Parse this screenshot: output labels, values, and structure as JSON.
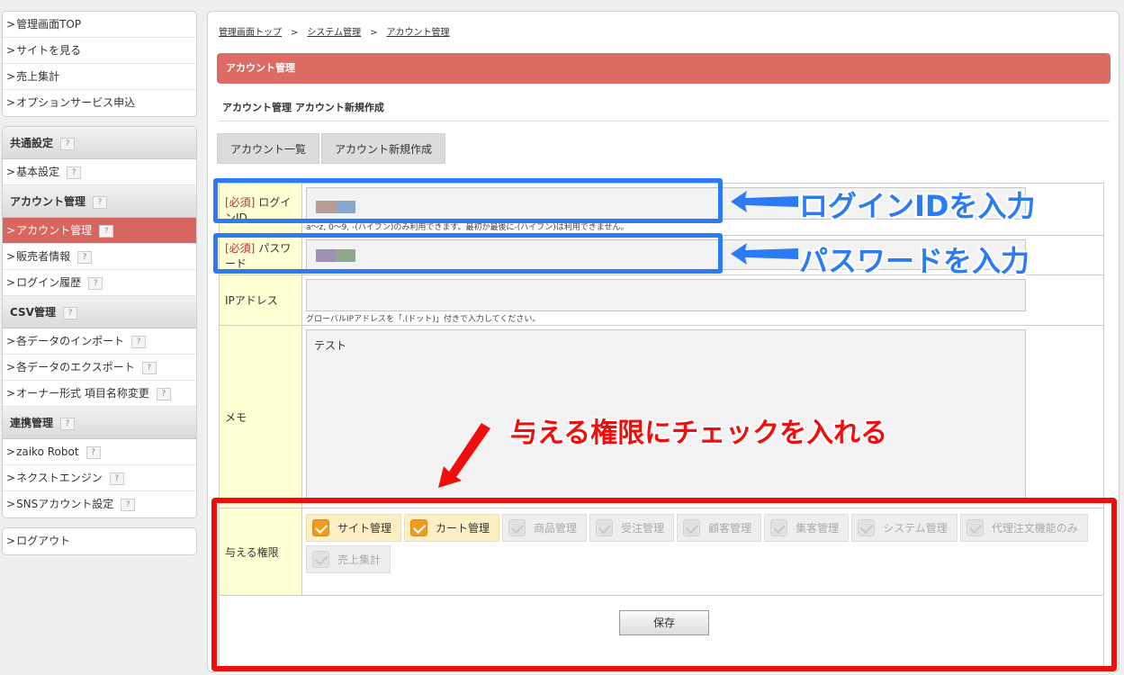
{
  "sidebar": {
    "top_items": [
      "管理画面TOP",
      "サイトを見る",
      "売上集計",
      "オプションサービス申込"
    ],
    "sections": [
      {
        "title": "共通設定",
        "items": [
          "基本設定"
        ]
      },
      {
        "title": "アカウント管理",
        "items": [
          "アカウント管理",
          "販売者情報",
          "ログイン履歴"
        ]
      },
      {
        "title": "CSV管理",
        "items": [
          "各データのインポート",
          "各データのエクスポート",
          "オーナー形式 項目名称変更"
        ]
      },
      {
        "title": "連携管理",
        "items": [
          "zaiko Robot",
          "ネクストエンジン",
          "SNSアカウント設定"
        ]
      }
    ],
    "logout": "ログアウト",
    "arrow": ">",
    "help": "?"
  },
  "breadcrumb": [
    "管理画面トップ",
    "システム管理",
    "アカウント管理"
  ],
  "breadcrumb_sep": ">",
  "page_title": "アカウント管理",
  "subtitle": "アカウント管理 アカウント新規作成",
  "tabs": [
    "アカウント一覧",
    "アカウント新規作成"
  ],
  "form": {
    "required_mark": "[必須]",
    "login_label": "ログインID",
    "login_hint": "a～z, 0～9, -(ハイフン)のみ利用できます。最初か最後に-(ハイフン)は利用できません。",
    "password_label": "パスワード",
    "ip_label": "IPアドレス",
    "ip_hint": "グローバルIPアドレスを「.(ドット)」付きで入力してください。",
    "memo_label": "メモ",
    "memo_value": "テスト",
    "perm_label": "与える権限",
    "permissions": [
      {
        "label": "サイト管理",
        "checked": true
      },
      {
        "label": "カート管理",
        "checked": true
      },
      {
        "label": "商品管理",
        "checked": false
      },
      {
        "label": "受注管理",
        "checked": false
      },
      {
        "label": "顧客管理",
        "checked": false
      },
      {
        "label": "集客管理",
        "checked": false
      },
      {
        "label": "システム管理",
        "checked": false
      },
      {
        "label": "代理注文機能のみ",
        "checked": false
      },
      {
        "label": "売上集計",
        "checked": false
      }
    ],
    "save_label": "保存"
  },
  "annotations": {
    "login": "ログインIDを入力",
    "password": "パスワードを入力",
    "permissions": "与える権限にチェックを入れる"
  },
  "colors": {
    "accent_red": "#dd6b63",
    "annotation_blue": "#2b7cf4",
    "annotation_red": "#f20d0d",
    "checkbox_orange": "#f29a1d"
  }
}
